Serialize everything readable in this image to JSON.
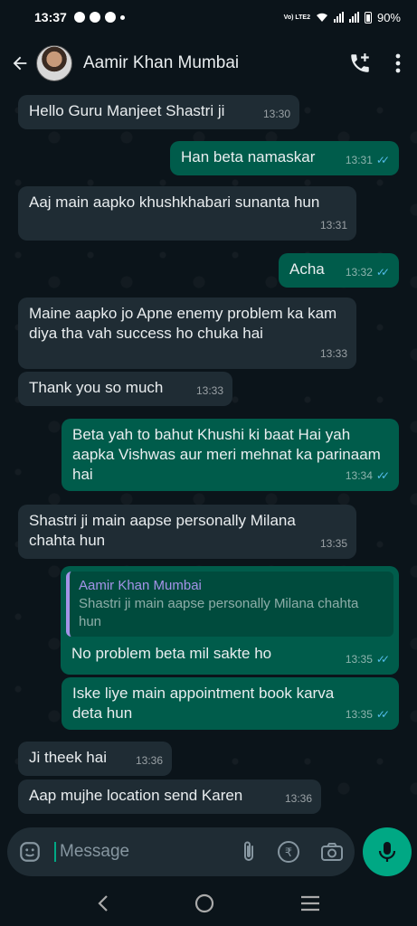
{
  "status_bar": {
    "time": "13:37",
    "battery": "90%",
    "network": "Vo) LTE2"
  },
  "header": {
    "contact_name": "Aamir Khan Mumbai"
  },
  "messages": [
    {
      "dir": "in",
      "text": "Hello Guru Manjeet Shastri ji",
      "time": "13:30"
    },
    {
      "dir": "out",
      "text": "Han beta namaskar",
      "time": "13:31"
    },
    {
      "dir": "in",
      "text": "Aaj main aapko khushkhabari sunanta hun",
      "time": "13:31"
    },
    {
      "dir": "out",
      "text": "Acha",
      "time": "13:32"
    },
    {
      "dir": "in",
      "text": "Maine aapko jo Apne enemy problem ka kam diya tha vah success ho chuka hai",
      "time": "13:33"
    },
    {
      "dir": "in",
      "text": "Thank you so much",
      "time": "13:33"
    },
    {
      "dir": "out",
      "text": "Beta yah to bahut Khushi ki baat Hai yah aapka Vishwas aur meri mehnat ka parinaam hai",
      "time": "13:34"
    },
    {
      "dir": "in",
      "text": "Shastri ji main aapse personally Milana chahta hun",
      "time": "13:35"
    },
    {
      "dir": "out",
      "text": "No problem beta mil sakte ho",
      "time": "13:35",
      "quote_name": "Aamir Khan Mumbai",
      "quote_text": "Shastri ji main aapse personally Milana chahta hun"
    },
    {
      "dir": "out",
      "text": "Iske liye main appointment book karva deta hun",
      "time": "13:35"
    },
    {
      "dir": "in",
      "text": "Ji theek hai",
      "time": "13:36"
    },
    {
      "dir": "in",
      "text": "Aap mujhe location send Karen",
      "time": "13:36"
    }
  ],
  "composer": {
    "placeholder": "Message"
  },
  "colors": {
    "background": "#0b141a",
    "incoming": "#1f2c34",
    "outgoing": "#005c4b",
    "accent": "#00a884",
    "read_ticks": "#53bdeb"
  }
}
